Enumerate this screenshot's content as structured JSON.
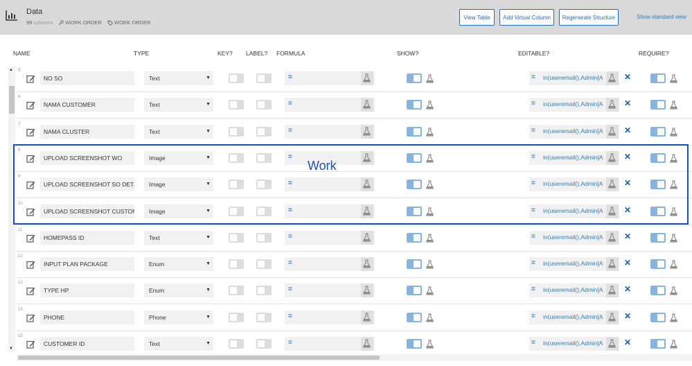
{
  "header": {
    "title": "Data",
    "column_count": "99",
    "columns_word": "columns",
    "tags": [
      "WORK ORDER",
      "WORK ORDER"
    ],
    "buttons": {
      "view_table": "View Table",
      "add_virtual_column": "Add Virtual Column",
      "regenerate_structure": "Regenerate Structure"
    },
    "show_standard_view": "Show standard view"
  },
  "columns": {
    "name": "NAME",
    "type": "TYPE",
    "key": "KEY?",
    "label": "LABEL?",
    "formula": "FORMULA",
    "show": "SHOW?",
    "editable": "EDITABLE?",
    "require": "REQUIRE?"
  },
  "rows": [
    {
      "num": "5",
      "name": "NO SO",
      "type": "Text",
      "editable_expr": "in(useremail(),Admin[A"
    },
    {
      "num": "6",
      "name": "NAMA CUSTOMER",
      "type": "Text",
      "editable_expr": "in(useremail(),Admin[A"
    },
    {
      "num": "7",
      "name": "NAMA CLUSTER",
      "type": "Text",
      "editable_expr": "in(useremail(),Admin[A"
    },
    {
      "num": "8",
      "name": "UPLOAD SCREENSHOT WO",
      "type": "Image",
      "editable_expr": "in(useremail(),Admin[A"
    },
    {
      "num": "9",
      "name": "UPLOAD SCREENSHOT SO DET/",
      "type": "Image",
      "editable_expr": "in(useremail(),Admin[A"
    },
    {
      "num": "10",
      "name": "UPLOAD SCREENSHOT CUSTON",
      "type": "Image",
      "editable_expr": "in(useremail(),Admin[A"
    },
    {
      "num": "11",
      "name": "HOMEPASS ID",
      "type": "Text",
      "editable_expr": "in(useremail(),Admin[A"
    },
    {
      "num": "12",
      "name": "INPUT PLAN PACKAGE",
      "type": "Enum",
      "editable_expr": "in(useremail(),Admin[A"
    },
    {
      "num": "13",
      "name": "TYPE HP",
      "type": "Enum",
      "editable_expr": "in(useremail(),Admin[A"
    },
    {
      "num": "14",
      "name": "PHONE",
      "type": "Phone",
      "editable_expr": "in(useremail(),Admin[A"
    },
    {
      "num": "15",
      "name": "CUSTOMER ID",
      "type": "Text",
      "editable_expr": "in(useremail(),Admin[A"
    }
  ],
  "annotation": "Work",
  "colors": {
    "accent": "#2a7fc1",
    "highlight": "#1a4fb5",
    "toggle_on": "#8ab4e0"
  }
}
